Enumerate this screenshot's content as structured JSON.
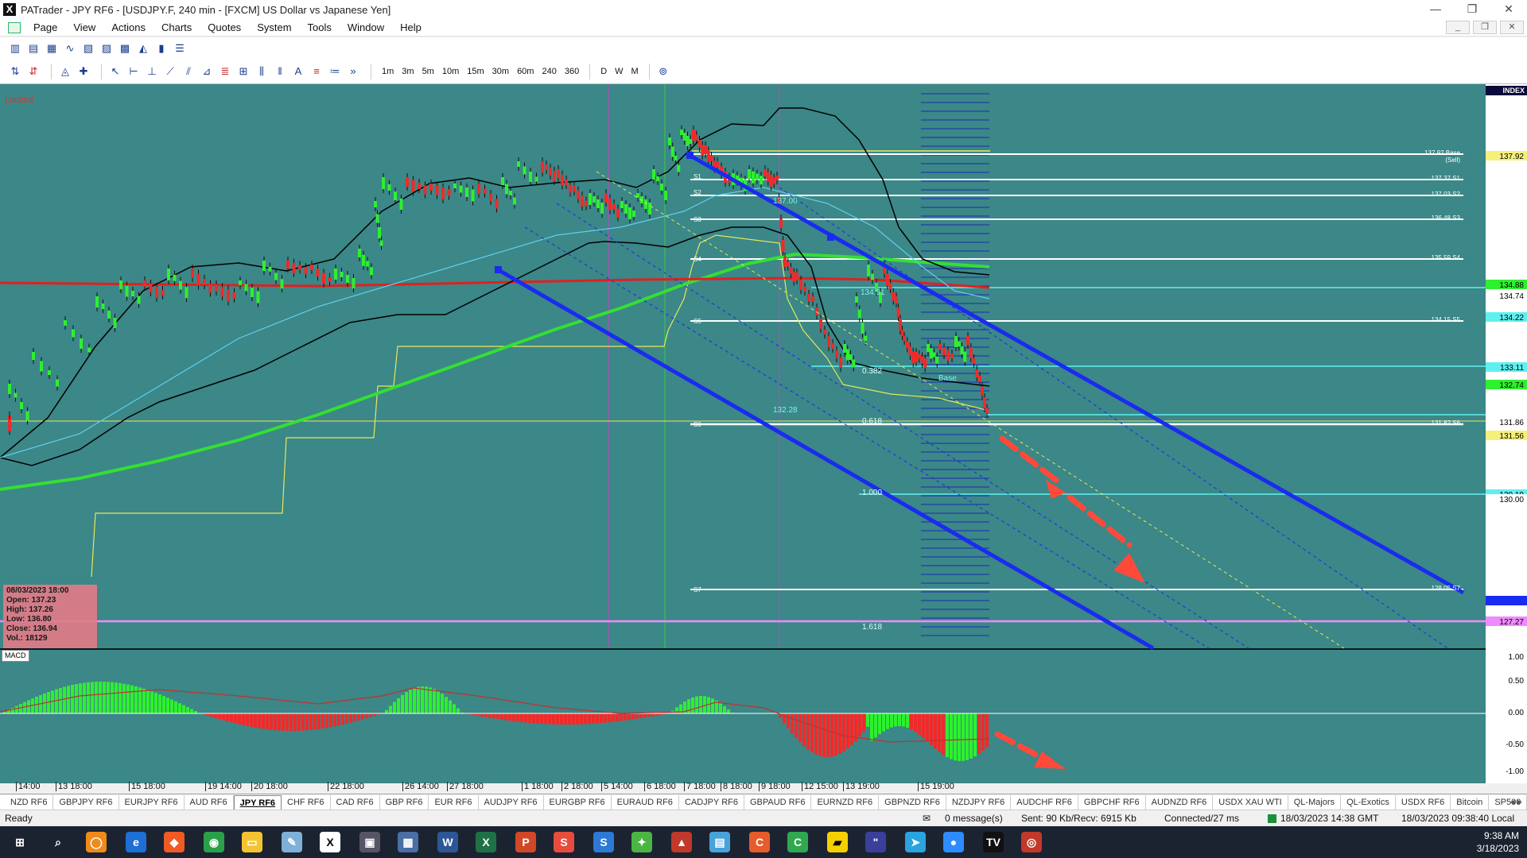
{
  "window": {
    "title": "PATrader - JPY RF6 - [USDJPY.F, 240 min - [FXCM] US Dollar vs Japanese Yen]",
    "controls": [
      "—",
      "❐",
      "✕"
    ],
    "mdi_controls": [
      "_",
      "❐",
      "✕"
    ]
  },
  "menu": [
    "Page",
    "View",
    "Actions",
    "Charts",
    "Quotes",
    "System",
    "Tools",
    "Window",
    "Help"
  ],
  "toolbar": {
    "periods": [
      "1m",
      "3m",
      "5m",
      "10m",
      "15m",
      "30m",
      "60m",
      "240",
      "360",
      "D",
      "W",
      "M"
    ]
  },
  "chart": {
    "locked": "Locked",
    "index_label": "INDEX",
    "price_labels": [
      "137.92",
      "134.88",
      "134.74",
      "134.22",
      "133.11",
      "132.74",
      "131.86",
      "131.56",
      "130.19",
      "130.00",
      "127.27"
    ],
    "pivot_labels": [
      "137.92 Base (Sell)",
      "137.37 S1",
      "137.03 S2",
      "136.48 S3",
      "135.59 S4",
      "134.15 S5",
      "131.82 S6",
      "128.05 S7"
    ],
    "pivot_tags": [
      "S1",
      "S2",
      "S3",
      "S4",
      "S5",
      "S6",
      "S7"
    ],
    "fib_labels": [
      "0.382",
      "0.618",
      "1.000",
      "1.618"
    ],
    "mid_labels": [
      "137.00",
      "134.91",
      "132.28",
      "Base"
    ],
    "macd_label": "MACD",
    "macd_scale": [
      "1.00",
      "0.50",
      "0.00",
      "-0.50",
      "-1.00"
    ],
    "ohlc": {
      "date": "08/03/2023 18:00",
      "open": "Open: 137.23",
      "high": "High: 137.26",
      "low": "Low: 136.80",
      "close": "Close: 136.94",
      "vol": "Vol.: 18129"
    },
    "date_labels": [
      "14:00",
      "13 18:00",
      "15 18:00",
      "19 14:00",
      "20 18:00",
      "22 18:00",
      "26 14:00",
      "27 18:00",
      "1 18:00",
      "2 18:00",
      "5 14:00",
      "6 18:00",
      "7 18:00",
      "8 18:00",
      "9 18:00",
      "12 15:00",
      "13 19:00",
      "15 19:00"
    ]
  },
  "tabs": [
    "NZD RF6",
    "GBPJPY RF6",
    "EURJPY RF6",
    "AUD RF6",
    "JPY RF6",
    "CHF RF6",
    "CAD RF6",
    "GBP RF6",
    "EUR RF6",
    "AUDJPY RF6",
    "EURGBP RF6",
    "EURAUD RF6",
    "CADJPY RF6",
    "GBPAUD RF6",
    "EURNZD RF6",
    "GBPNZD RF6",
    "NZDJPY RF6",
    "AUDCHF RF6",
    "GBPCHF RF6",
    "AUDNZD RF6",
    "USDX XAU WTI",
    "QL-Majors",
    "QL-Exotics",
    "USDX RF6",
    "Bitcoin",
    "SP500"
  ],
  "active_tab": "JPY RF6",
  "status": {
    "ready": "Ready",
    "messages": "0 message(s)",
    "traffic": "Sent: 90 Kb/Recv: 6915 Kb",
    "connected": "Connected/27 ms",
    "server_time": "18/03/2023 14:38 GMT",
    "local_time": "18/03/2023 09:38:40 Local"
  },
  "taskbar": {
    "time": "9:38 AM",
    "date": "3/18/2023"
  }
}
